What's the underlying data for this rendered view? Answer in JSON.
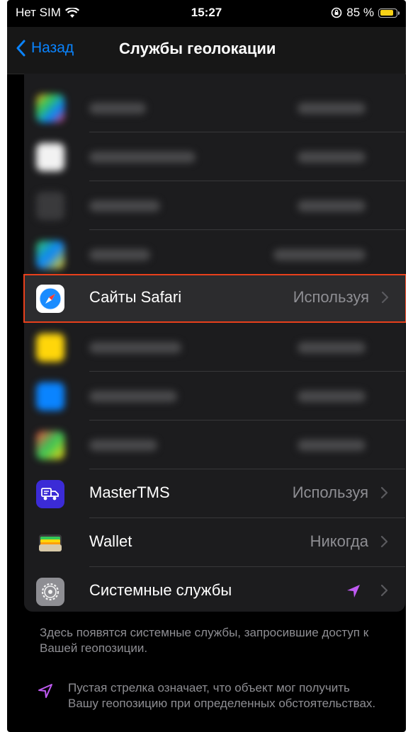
{
  "status_bar": {
    "carrier": "Нет SIM",
    "time": "15:27",
    "battery_percent": "85 %",
    "battery_level": 0.85,
    "battery_color": "#f7d117"
  },
  "nav": {
    "back_label": "Назад",
    "title": "Службы геолокации"
  },
  "rows": [
    {
      "label": "Сайты Safari",
      "value": "Используя",
      "icon": "safari-icon",
      "highlighted": true
    },
    {
      "label": "MasterTMS",
      "value": "Используя",
      "icon": "mastertms-icon"
    },
    {
      "label": "Wallet",
      "value": "Никогда",
      "icon": "wallet-icon"
    },
    {
      "label": "Системные службы",
      "value": "",
      "icon": "gear-icon",
      "indicator": "location-arrow-icon"
    }
  ],
  "footer": {
    "system_services_note": "Здесь появятся системные службы, запросившие доступ к Вашей геопозиции.",
    "hollow_arrow_note": "Пустая стрелка означает, что объект мог получить Вашу геопозицию при определенных обстоятельствах."
  },
  "colors": {
    "accent": "#0a84ff",
    "highlight_border": "#e8401c",
    "location_arrow": "#bf5af2"
  }
}
